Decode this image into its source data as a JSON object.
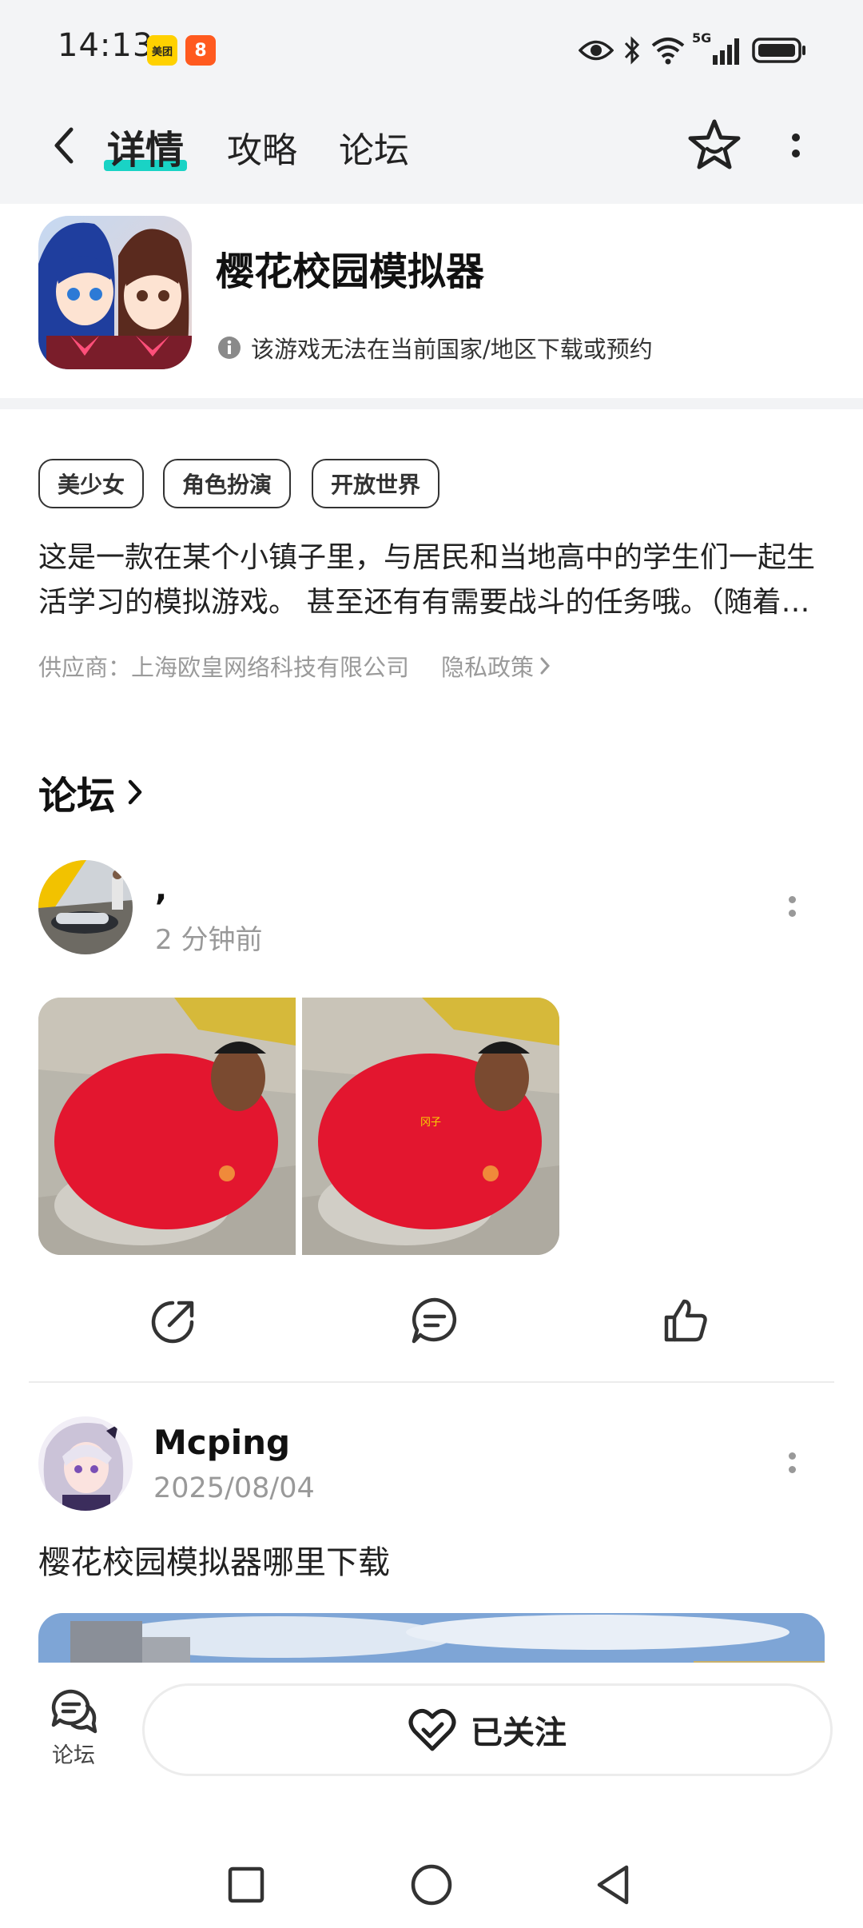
{
  "status_bar": {
    "time": "14:13",
    "app_badges": [
      "美团",
      "8"
    ],
    "icons": [
      "eye-icon",
      "bluetooth-icon",
      "wifi-icon",
      "5g-signal-icon",
      "battery-icon"
    ],
    "network_label": "5G"
  },
  "top_nav": {
    "tabs": [
      {
        "label": "详情",
        "active": true
      },
      {
        "label": "攻略",
        "active": false
      },
      {
        "label": "论坛",
        "active": false
      }
    ],
    "accent_color": "#19d3c5"
  },
  "app": {
    "title": "樱花校园模拟器",
    "unavailable_notice": "该游戏无法在当前国家/地区下载或预约",
    "tags": [
      "美少女",
      "角色扮演",
      "开放世界"
    ],
    "description_line1": "这是一款在某个小镇子里，与居民和当地高中的学生们一起生",
    "description_line2": "活学习的模拟游戏。 甚至还有有需要战斗的任务哦。（随着…",
    "supplier": "供应商：上海欧皇网络科技有限公司",
    "privacy_link": "隐私政策"
  },
  "forum": {
    "heading": "论坛",
    "posts": [
      {
        "username": ",",
        "time": "2 分钟前",
        "image_caption": "冈子"
      },
      {
        "username": "Mcping",
        "time": "2025/08/04",
        "text": "樱花校园模拟器哪里下载"
      }
    ]
  },
  "bottom_bar": {
    "forum_label": "论坛",
    "follow_label": "已关注"
  }
}
